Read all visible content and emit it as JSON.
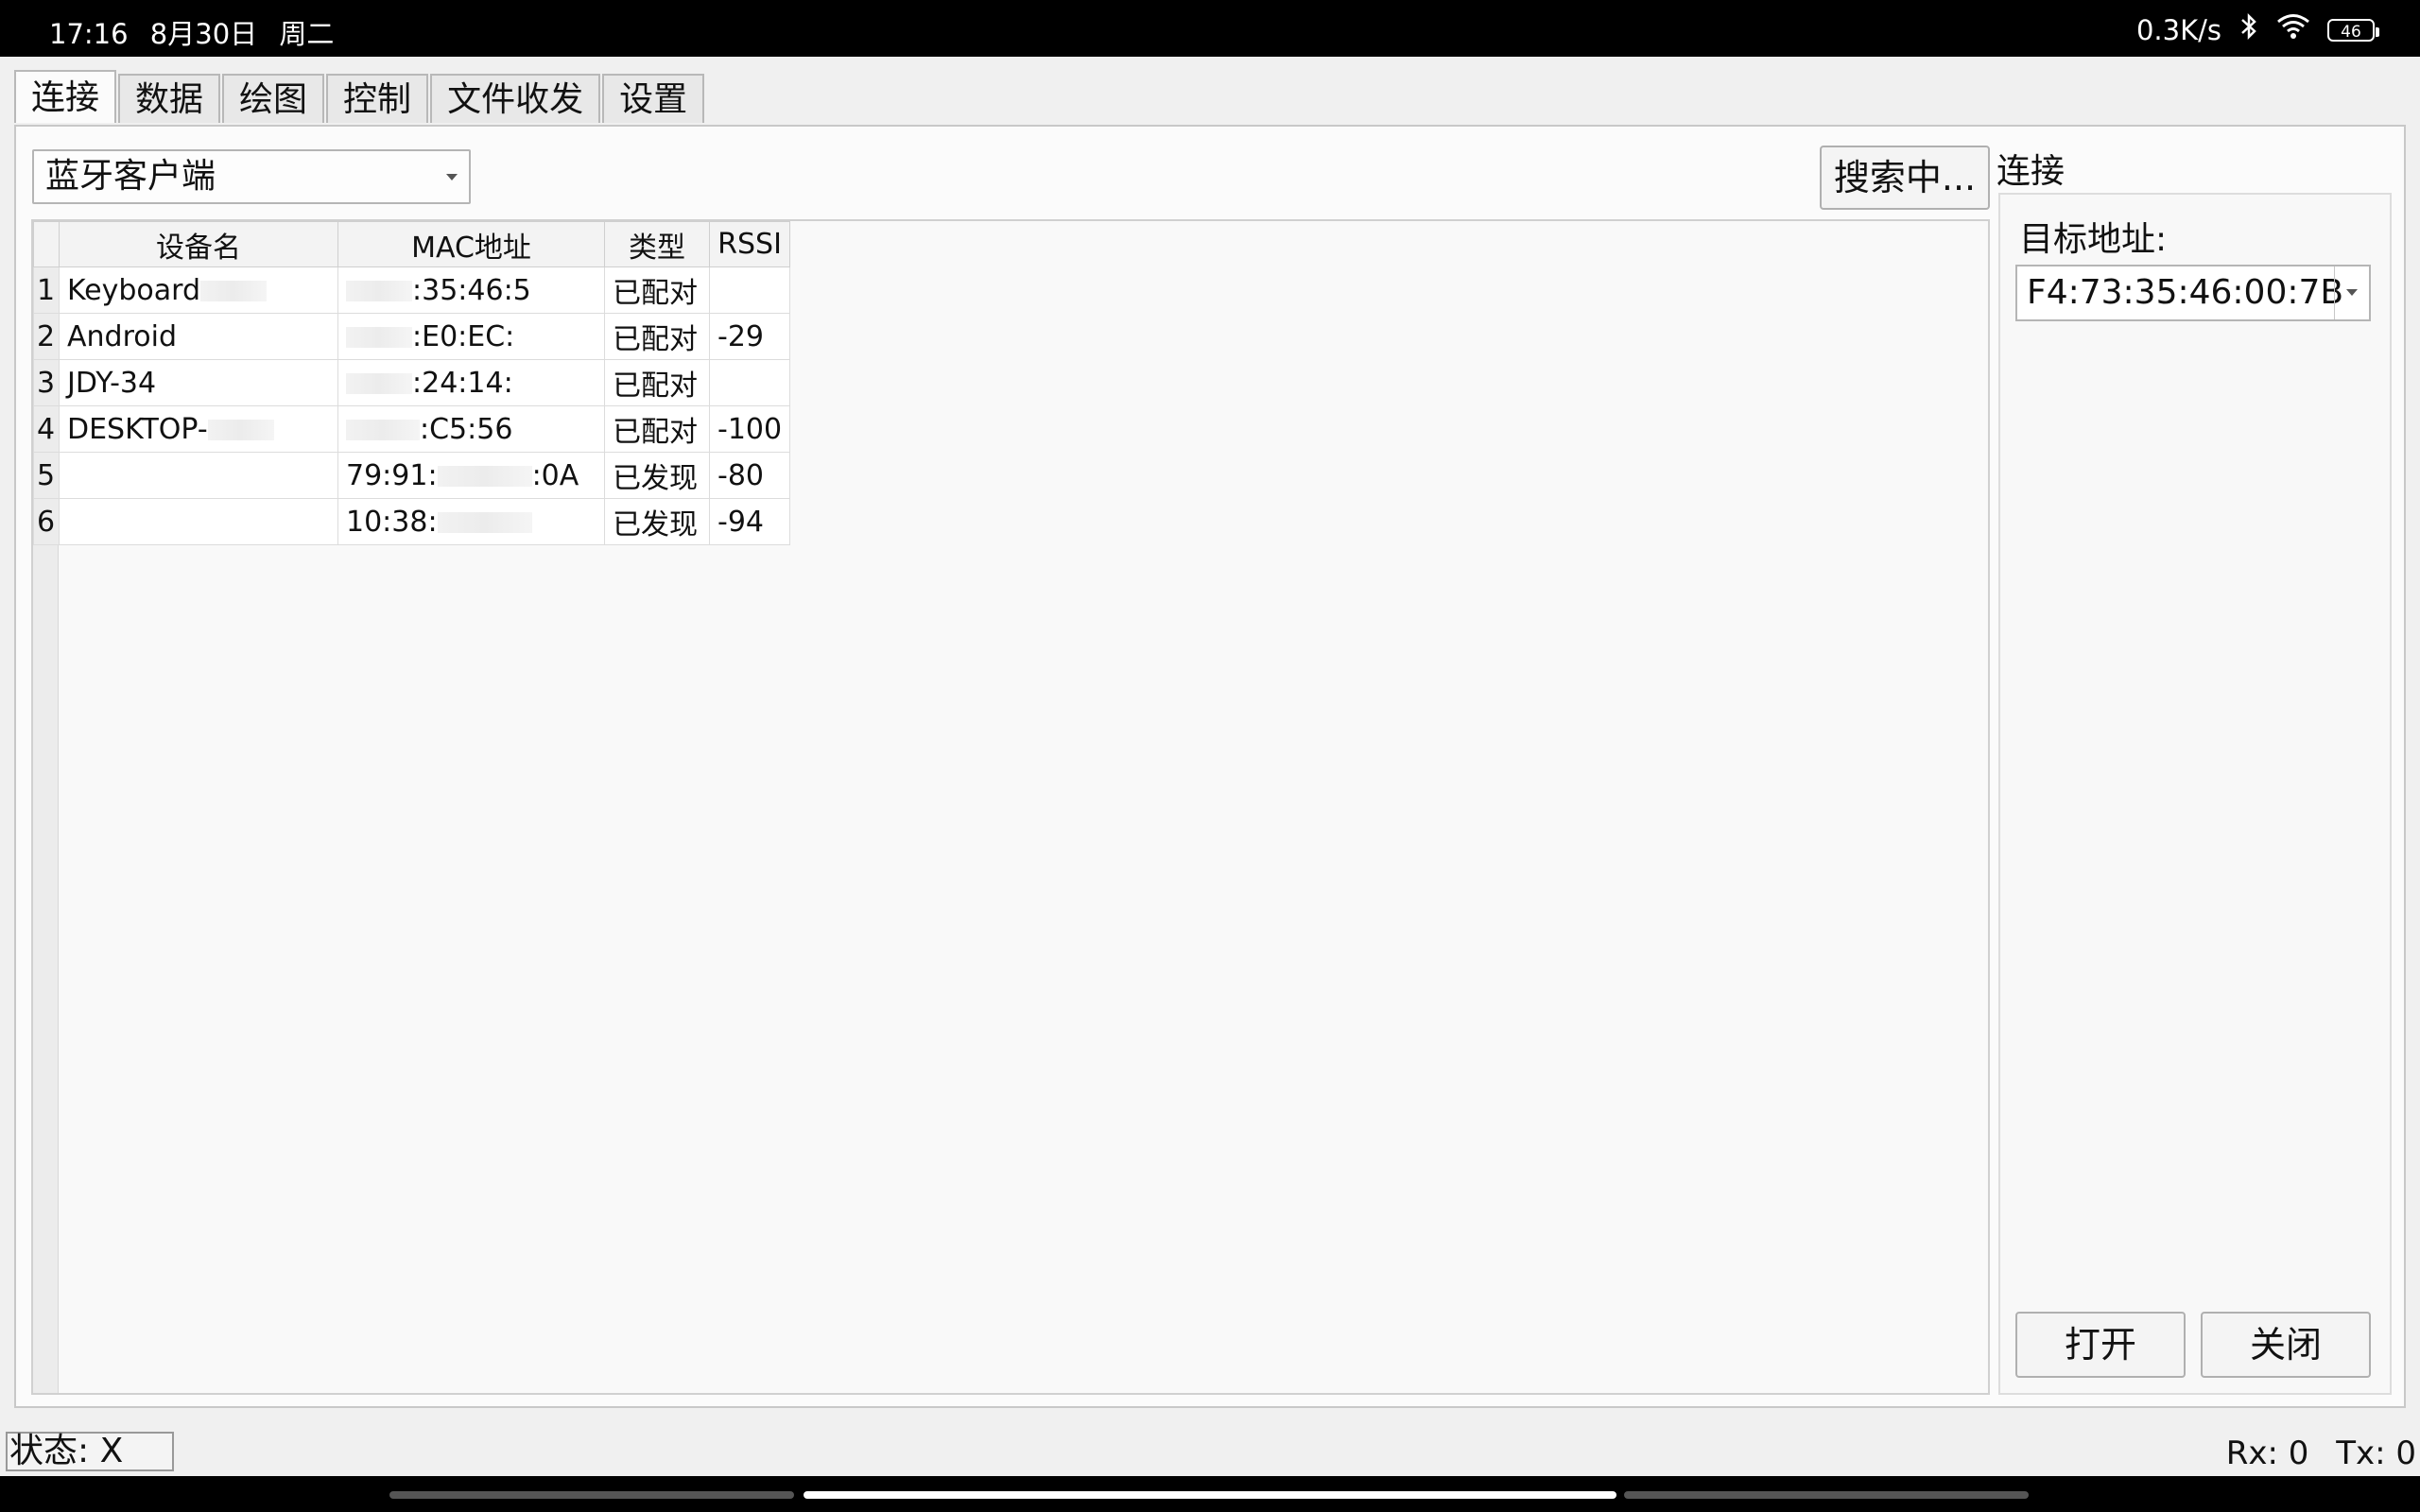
{
  "status_bar": {
    "time": "17:16",
    "date": "8月30日",
    "weekday": "周二",
    "net_speed": "0.3K/s",
    "battery": "46",
    "icons": [
      "bluetooth-icon",
      "wifi-icon",
      "battery-icon"
    ]
  },
  "tabs": [
    {
      "label": "连接",
      "active": true
    },
    {
      "label": "数据"
    },
    {
      "label": "绘图"
    },
    {
      "label": "控制"
    },
    {
      "label": "文件收发"
    },
    {
      "label": "设置"
    }
  ],
  "mode_select": {
    "value": "蓝牙客户端"
  },
  "search_button": {
    "label": "搜索中..."
  },
  "table": {
    "headers": [
      "设备名",
      "MAC地址",
      "类型",
      "RSSI"
    ],
    "rows": [
      {
        "num": "1",
        "name": "Keyboard",
        "mac": ":35:46:5",
        "type": "已配对",
        "rssi": ""
      },
      {
        "num": "2",
        "name": "Android",
        "mac": ":E0:EC:",
        "type": "已配对",
        "rssi": "-29"
      },
      {
        "num": "3",
        "name": "JDY-34",
        "mac": ":24:14:",
        "type": "已配对",
        "rssi": ""
      },
      {
        "num": "4",
        "name": "DESKTOP-",
        "mac": ":C5:56",
        "type": "已配对",
        "rssi": "-100"
      },
      {
        "num": "5",
        "name": "",
        "mac": "79:91:",
        "mac_tail": ":0A",
        "type": "已发现",
        "rssi": "-80"
      },
      {
        "num": "6",
        "name": "",
        "mac": "10:38:",
        "type": "已发现",
        "rssi": "-94"
      }
    ]
  },
  "connect_panel": {
    "title": "连接",
    "target_label": "目标地址:",
    "target_value": "F4:73:35:46:00:7B",
    "open_label": "打开",
    "close_label": "关闭"
  },
  "footer": {
    "state": "状态: X",
    "rx": "Rx: 0",
    "tx": "Tx: 0"
  }
}
